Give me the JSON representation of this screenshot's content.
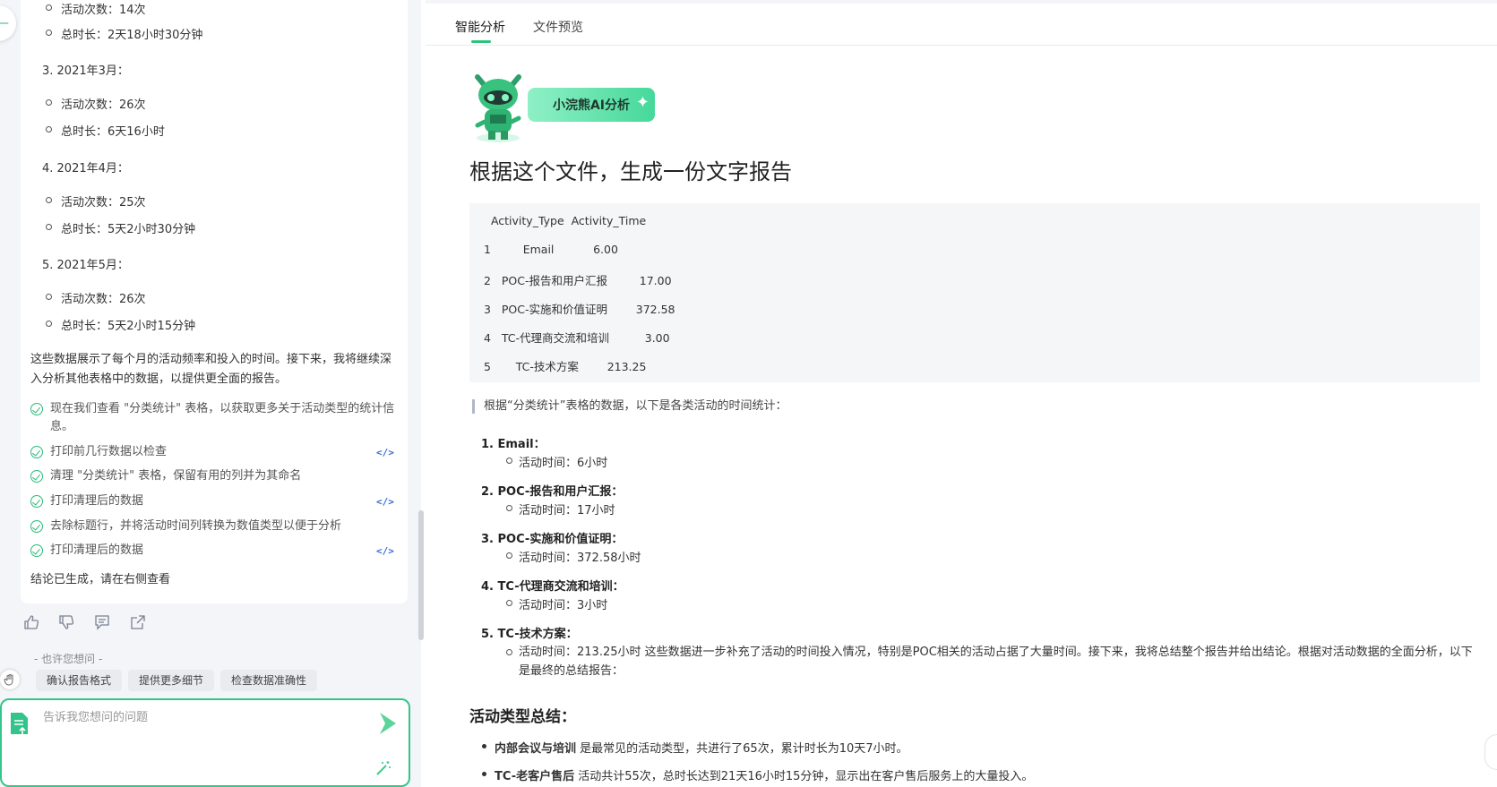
{
  "left": {
    "lines": [
      {
        "kind": "bul",
        "text": "活动次数：14次"
      },
      {
        "kind": "bul",
        "text": "总时长：2天18小时30分钟"
      },
      {
        "kind": "num",
        "text": "3. 2021年3月："
      },
      {
        "kind": "bul",
        "text": "活动次数：26次"
      },
      {
        "kind": "bul",
        "text": "总时长：6天16小时"
      },
      {
        "kind": "num",
        "text": "4. 2021年4月："
      },
      {
        "kind": "bul",
        "text": "活动次数：25次"
      },
      {
        "kind": "bul",
        "text": "总时长：5天2小时30分钟"
      },
      {
        "kind": "num",
        "text": "5. 2021年5月："
      },
      {
        "kind": "bul",
        "text": "活动次数：26次"
      },
      {
        "kind": "bul",
        "text": "总时长：5天2小时15分钟"
      }
    ],
    "summary_para": "这些数据展示了每个月的活动频率和投入的时间。接下来，我将继续深入分析其他表格中的数据，以提供更全面的报告。",
    "steps": [
      {
        "text": "现在我们查看 \"分类统计\" 表格，以获取更多关于活动类型的统计信息。",
        "code": false
      },
      {
        "text": "打印前几行数据以检查",
        "code": true
      },
      {
        "text": "清理 \"分类统计\" 表格，保留有用的列并为其命名",
        "code": false
      },
      {
        "text": "打印清理后的数据",
        "code": true
      },
      {
        "text": "去除标题行，并将活动时间列转换为数值类型以便于分析",
        "code": false
      },
      {
        "text": "打印清理后的数据",
        "code": true
      }
    ],
    "code_icon": "</>",
    "conclusion": "结论已生成，请在右侧查看",
    "feedback_icons": [
      "thumbs-up-icon",
      "thumbs-down-icon",
      "comment-icon",
      "share-icon"
    ],
    "suggest_title": "- 也许您想问 -",
    "chips": [
      "确认报告格式",
      "提供更多细节",
      "检查数据准确性"
    ],
    "input_placeholder": "告诉我您想问的问题"
  },
  "right": {
    "tabs": [
      "智能分析",
      "文件预览"
    ],
    "badge": "小浣熊AI分析",
    "question": "根据这个文件，生成一份文字报告",
    "data_lines": [
      "  Activity_Type  Activity_Time",
      "1         Email           6.00",
      "2   POC-报告和用户汇报         17.00",
      "3   POC-实施和价值证明        372.58",
      "4   TC-代理商交流和培训          3.00",
      "5       TC-技术方案        213.25"
    ],
    "quote": "根据“分类统计”表格的数据，以下是各类活动的时间统计：",
    "items": [
      {
        "title": "1. Email：",
        "sub": "活动时间：6小时"
      },
      {
        "title": "2. POC-报告和用户汇报：",
        "sub": "活动时间：17小时"
      },
      {
        "title": "3. POC-实施和价值证明：",
        "sub": "活动时间：372.58小时"
      },
      {
        "title": "4. TC-代理商交流和培训：",
        "sub": "活动时间：3小时"
      },
      {
        "title": "5. TC-技术方案："
      }
    ],
    "item5_text": "活动时间：213.25小时 这些数据进一步补充了活动的时间投入情况，特别是POC相关的活动占据了大量时间。接下来，我将总结整个报告并给出结论。根据对活动数据的全面分析，以下是最终的总结报告：",
    "summary_heading": "活动类型总结：",
    "summary": [
      {
        "bold": "内部会议与培训",
        "rest": " 是最常见的活动类型，共进行了65次，累计时长为10天7小时。"
      },
      {
        "bold": "TC-老客户售后",
        "rest": " 活动共计55次，总时长达到21天16小时15分钟，显示出在客户售后服务上的大量投入。"
      }
    ]
  }
}
